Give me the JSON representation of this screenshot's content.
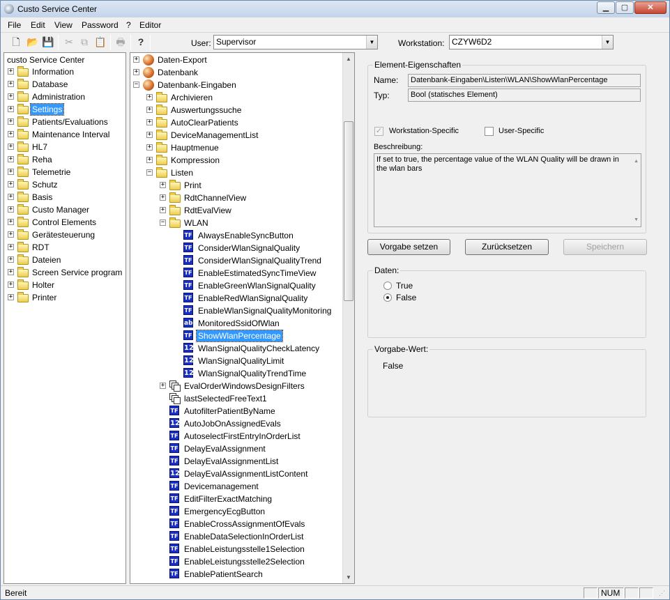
{
  "window": {
    "title": "Custo Service Center"
  },
  "menu": [
    "File",
    "Edit",
    "View",
    "Password",
    "?",
    "Editor"
  ],
  "toolbar": {
    "user_label": "User:",
    "user_value": "Supervisor",
    "workstation_label": "Workstation:",
    "workstation_value": "CZYW6D2"
  },
  "left_tree": {
    "root": "custo Service Center",
    "items": [
      "Information",
      "Database",
      "Administration",
      "Settings",
      "Patients/Evaluations",
      "Maintenance Interval",
      "HL7",
      "Reha",
      "Telemetrie",
      "Schutz",
      "Basis",
      "Custo Manager",
      "Control Elements",
      "Gerätesteuerung",
      "RDT",
      "Dateien",
      "Screen Service program",
      "Holter",
      "Printer"
    ],
    "selected": "Settings"
  },
  "mid_tree": {
    "top": [
      "Daten-Export",
      "Datenbank",
      "Datenbank-Eingaben"
    ],
    "eingaben_children": [
      "Archivieren",
      "Auswertungssuche",
      "AutoClearPatients",
      "DeviceManagementList",
      "Hauptmenue",
      "Kompression",
      "Listen"
    ],
    "listen_children": [
      "Print",
      "RdtChannelView",
      "RdtEvalView",
      "WLAN"
    ],
    "wlan_children": [
      {
        "icon": "TF",
        "label": "AlwaysEnableSyncButton"
      },
      {
        "icon": "TF",
        "label": "ConsiderWlanSignalQuality"
      },
      {
        "icon": "TF",
        "label": "ConsiderWlanSignalQualityTrend"
      },
      {
        "icon": "TF",
        "label": "EnableEstimatedSyncTimeView"
      },
      {
        "icon": "TF",
        "label": "EnableGreenWlanSignalQuality"
      },
      {
        "icon": "TF",
        "label": "EnableRedWlanSignalQuality"
      },
      {
        "icon": "TF",
        "label": "EnableWlanSignalQualityMonitoring"
      },
      {
        "icon": "ab",
        "label": "MonitoredSsidOfWlan"
      },
      {
        "icon": "TF",
        "label": "ShowWlanPercentage"
      },
      {
        "icon": "12",
        "label": "WlanSignalQualityCheckLatency"
      },
      {
        "icon": "12",
        "label": "WlanSignalQualityLimit"
      },
      {
        "icon": "12",
        "label": "WlanSignalQualityTrendTime"
      }
    ],
    "selected": "ShowWlanPercentage",
    "eingaben_elements": [
      {
        "icon": "multi",
        "label": "EvalOrderWindowsDesignFilters",
        "expandable": true
      },
      {
        "icon": "multi",
        "label": "lastSelectedFreeText1"
      },
      {
        "icon": "TF",
        "label": "AutofilterPatientByName"
      },
      {
        "icon": "12",
        "label": "AutoJobOnAssignedEvals"
      },
      {
        "icon": "TF",
        "label": "AutoselectFirstEntryInOrderList"
      },
      {
        "icon": "TF",
        "label": "DelayEvalAssignment"
      },
      {
        "icon": "TF",
        "label": "DelayEvalAssignmentList"
      },
      {
        "icon": "12",
        "label": "DelayEvalAssignmentListContent"
      },
      {
        "icon": "TF",
        "label": "Devicemanagement"
      },
      {
        "icon": "TF",
        "label": "EditFilterExactMatching"
      },
      {
        "icon": "TF",
        "label": "EmergencyEcgButton"
      },
      {
        "icon": "TF",
        "label": "EnableCrossAssignmentOfEvals"
      },
      {
        "icon": "TF",
        "label": "EnableDataSelectionInOrderList"
      },
      {
        "icon": "TF",
        "label": "EnableLeistungsstelle1Selection"
      },
      {
        "icon": "TF",
        "label": "EnableLeistungsstelle2Selection"
      },
      {
        "icon": "TF",
        "label": "EnablePatientSearch"
      }
    ]
  },
  "props": {
    "group_title": "Element-Eigenschaften",
    "name_label": "Name:",
    "name_value": "Datenbank-Eingaben\\Listen\\WLAN\\ShowWlanPercentage",
    "type_label": "Typ:",
    "type_value": "Bool (statisches Element)",
    "workstation_specific": "Workstation-Specific",
    "user_specific": "User-Specific",
    "desc_label": "Beschreibung:",
    "desc_value": "If set to true, the percentage value of the WLAN Quality will be drawn in the wlan bars"
  },
  "buttons": {
    "set_default": "Vorgabe setzen",
    "reset": "Zurücksetzen",
    "save": "Speichern"
  },
  "daten": {
    "title": "Daten:",
    "true_label": "True",
    "false_label": "False",
    "selected": "False"
  },
  "default": {
    "title": "Vorgabe-Wert:",
    "value": "False"
  },
  "status": {
    "text": "Bereit",
    "num": "NUM"
  }
}
